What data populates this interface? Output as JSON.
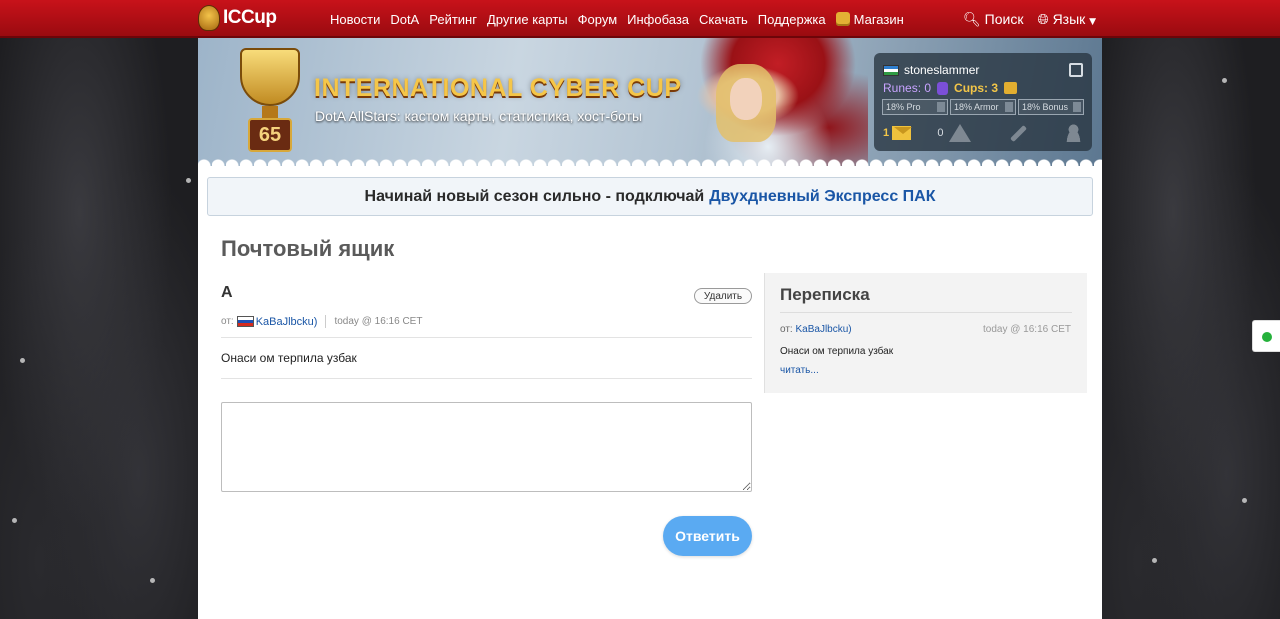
{
  "header": {
    "logo_text": "ICCup",
    "nav": [
      "Новости",
      "DotA",
      "Рейтинг",
      "Другие карты",
      "Форум",
      "Инфобаза",
      "Скачать",
      "Поддержка",
      "Магазин"
    ],
    "search_label": "Поиск",
    "language_label": "Язык"
  },
  "banner": {
    "title": "INTERNATIONAL CYBER CUP",
    "subtitle": "DotA AllStars: кастом карты, статистика, хост-боты",
    "level": "65"
  },
  "user_panel": {
    "username": "stoneslammer",
    "runes_label": "Runes: 0",
    "cups_label": "Cups: 3",
    "bars": [
      "18% Pro",
      "18% Armor",
      "18% Bonus"
    ],
    "mail_count": "1",
    "warnings_count": "0"
  },
  "promo": {
    "text": "Начинай новый сезон сильно - подключай",
    "link": "Двухдневный Экспресс ПАК"
  },
  "page_title": "Почтовый ящик",
  "message": {
    "subject": "А",
    "delete_label": "Удалить",
    "from_label": "от:",
    "author": "KaBaJlbcku)",
    "time": "today @ 16:16 CET",
    "body": "Онаси ом терпила узбак",
    "reply_placeholder": "",
    "reply_label": "Ответить"
  },
  "sidebar": {
    "title": "Переписка",
    "from_label": "от:",
    "author": "KaBaJlbcku)",
    "time": "today @ 16:16 CET",
    "text": "Онаси ом терпила узбак",
    "read_more": "читать..."
  },
  "colors": {
    "header_red": "#c8121a",
    "link_blue": "#1a56a6",
    "reply_button": "#5aaaf2",
    "online_green": "#25b13b"
  }
}
